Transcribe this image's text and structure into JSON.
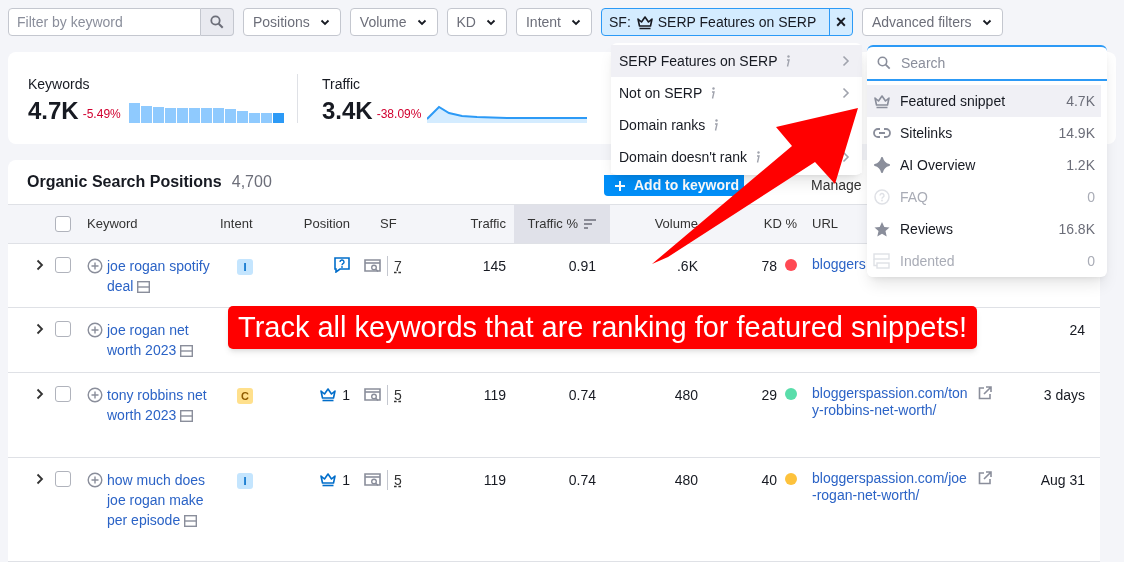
{
  "toolbar": {
    "search": {
      "placeholder": "Filter by keyword"
    },
    "filters": [
      {
        "label": "Positions"
      },
      {
        "label": "Volume"
      },
      {
        "label": "KD"
      },
      {
        "label": "Intent"
      }
    ],
    "active_filter": {
      "prefix": "SF:",
      "label": "SERP Features on SERP",
      "remove": "×"
    },
    "advanced": {
      "label": "Advanced filters"
    }
  },
  "summary": [
    {
      "label": "Keywords",
      "value": "4.7K",
      "change": "-5.49%",
      "kind": "bars"
    },
    {
      "label": "Traffic",
      "value": "3.4K",
      "change": "-38.09%",
      "kind": "line"
    }
  ],
  "table": {
    "title": "Organic Search Positions",
    "count": "4,700",
    "actions": [
      {
        "label": "Add to keyword",
        "kind": "primary"
      },
      {
        "label": "Manage",
        "kind": "secondary"
      }
    ],
    "select_all": {
      "checked": false
    },
    "columns": [
      {
        "label": "Keyword",
        "sorted": false
      },
      {
        "label": "Intent",
        "sorted": false
      },
      {
        "label": "Position",
        "sorted": false
      },
      {
        "label": "SF",
        "sorted": false
      },
      {
        "label": "Traffic",
        "sorted": false
      },
      {
        "label": "Traffic %",
        "sorted": true
      },
      {
        "label": "Volume",
        "sorted": false
      },
      {
        "label": "KD %",
        "sorted": false
      },
      {
        "label": "URL",
        "sorted": false
      }
    ],
    "rows": [
      {
        "checked": false,
        "keyword": "joe rogan spotify deal",
        "intent": {
          "label": "I",
          "color": "#c4e5fe"
        },
        "position": {
          "kind": "faq"
        },
        "sf": "7",
        "traffic": "145",
        "traffic_pct": "0.91",
        "volume": ".6K",
        "kd": {
          "value": "78",
          "color": "#ff4953"
        },
        "url": "bloggers"
      },
      {
        "checked": false,
        "keyword": "joe rogan net worth 2023",
        "updated": "24"
      },
      {
        "checked": false,
        "keyword": "tony robbins net worth 2023",
        "intent": {
          "label": "C",
          "color": "#ffe08c"
        },
        "position": {
          "kind": "crown",
          "value": "1"
        },
        "sf": "5",
        "traffic": "119",
        "traffic_pct": "0.74",
        "volume": "480",
        "kd": {
          "value": "29",
          "color": "#59ddaa"
        },
        "url": "bloggerspassion.com/tony-robbins-net-worth/",
        "updated": "3 days"
      },
      {
        "checked": false,
        "keyword": "how much does joe rogan make per episode",
        "intent": {
          "label": "I",
          "color": "#c4e5fe"
        },
        "position": {
          "kind": "crown",
          "value": "1"
        },
        "sf": "5",
        "traffic": "119",
        "traffic_pct": "0.74",
        "volume": "480",
        "kd": {
          "value": "40",
          "color": "#fdc23c"
        },
        "url": "bloggerspassion.com/joe-rogan-net-worth/",
        "updated": "Aug 31"
      }
    ]
  },
  "menu": [
    {
      "label": "SERP Features on SERP",
      "selected": true,
      "submenu": true
    },
    {
      "label": "Not on SERP",
      "selected": false,
      "submenu": true
    },
    {
      "label": "Domain ranks",
      "selected": false
    },
    {
      "label": "Domain doesn't rank",
      "selected": false,
      "submenu": true
    }
  ],
  "submenu": {
    "search": {
      "placeholder": "Search"
    },
    "items": [
      {
        "kind": "crown",
        "label": "Featured snippet",
        "count": "4.7K",
        "selected": true,
        "disabled": false
      },
      {
        "kind": "link",
        "label": "Sitelinks",
        "count": "14.9K",
        "selected": false,
        "disabled": false
      },
      {
        "kind": "ai",
        "label": "AI Overview",
        "count": "1.2K",
        "selected": false,
        "disabled": false
      },
      {
        "kind": "faq",
        "label": "FAQ",
        "count": "0",
        "selected": false,
        "disabled": true
      },
      {
        "kind": "star",
        "label": "Reviews",
        "count": "16.8K",
        "selected": false,
        "disabled": false
      },
      {
        "kind": "indented",
        "label": "Indented",
        "count": "0",
        "selected": false,
        "disabled": true
      }
    ]
  },
  "annotation": {
    "text": "Track all keywords that are ranking for featured snippets!"
  }
}
